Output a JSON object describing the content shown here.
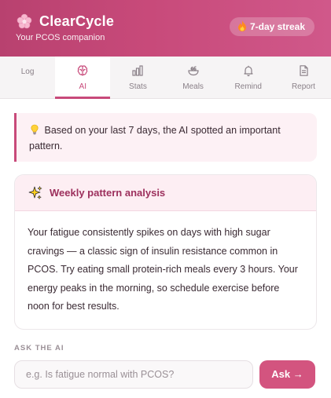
{
  "header": {
    "title": "ClearCycle",
    "subtitle": "Your PCOS companion",
    "streak_label": "7-day streak",
    "logo_icon": "flower-icon",
    "streak_icon": "fire-icon"
  },
  "tabs": [
    {
      "label": "Log",
      "icon": "none",
      "active": false
    },
    {
      "label": "AI",
      "icon": "brain-icon",
      "active": true
    },
    {
      "label": "Stats",
      "icon": "bar-chart-icon",
      "active": false
    },
    {
      "label": "Meals",
      "icon": "bowl-icon",
      "active": false
    },
    {
      "label": "Remind",
      "icon": "bell-icon",
      "active": false
    },
    {
      "label": "Report",
      "icon": "document-icon",
      "active": false
    }
  ],
  "insight": {
    "text": "Based on your last 7 days, the AI spotted an important pattern.",
    "icon": "lightbulb-icon"
  },
  "analysis": {
    "title": "Weekly pattern analysis",
    "icon": "sparkles-icon",
    "body": "Your fatigue consistently spikes on days with high sugar cravings — a classic sign of insulin resistance common in PCOS. Try eating small protein-rich meals every 3 hours. Your energy peaks in the morning, so schedule exercise before noon for best results."
  },
  "ask": {
    "label": "ASK THE AI",
    "placeholder": "e.g. Is fatigue normal with PCOS?",
    "value": "",
    "button_label": "Ask →"
  },
  "colors": {
    "brand": "#c84a7a",
    "accent_button": "#d3547f",
    "card_title": "#9c2f5c"
  }
}
